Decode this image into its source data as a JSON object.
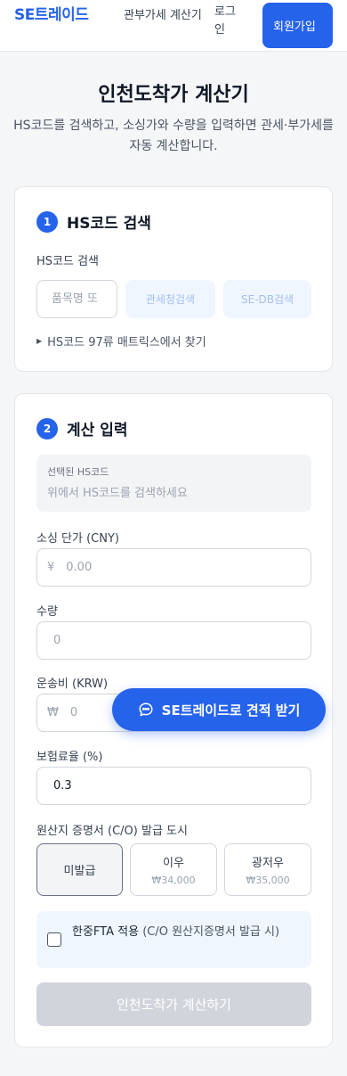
{
  "nav": {
    "logo": "SE트레이드",
    "link_tariff": "관부가세 계산기",
    "link_login": "로그인",
    "signup": "회원가입"
  },
  "page": {
    "title": "인천도착가 계산기",
    "subtitle": "HS코드를 검색하고, 소싱가와 수량을 입력하면 관세·부가세를 자동 계산합니다."
  },
  "step1": {
    "number": "1",
    "title": "HS코드 검색",
    "field_label": "HS코드 검색",
    "search_placeholder": "품목명 또",
    "customs_button": "관세청검색",
    "sedb_button": "SE-DB검색",
    "matrix_toggle": "HS코드 97류 매트릭스에서 찾기"
  },
  "step2": {
    "number": "2",
    "title": "계산 입력",
    "selected_hs_label": "선택된 HS코드",
    "selected_hs_value": "위에서 HS코드를 검색하세요",
    "unit_price_label": "소싱 단가 (CNY)",
    "unit_price_prefix": "¥",
    "unit_price_value": "0.00",
    "quantity_label": "수량",
    "quantity_value": "0",
    "shipping_label": "운송비 (KRW)",
    "shipping_prefix": "₩",
    "shipping_value": "0",
    "insurance_label": "보험료율 (%)",
    "insurance_value": "0.3",
    "origin_label": "원산지 증명서 (C/O) 발급 도시",
    "origin_options": [
      {
        "name": "미발급",
        "price": ""
      },
      {
        "name": "이우",
        "price": "₩34,000"
      },
      {
        "name": "광저우",
        "price": "₩35,000"
      }
    ],
    "origin_selected": "미발급",
    "fta_label": "한중FTA 적용",
    "fta_sub": "(C/O 원산지증명서 발급 시)",
    "fta_checked": false,
    "calc_button": "인천도착가 계산하기"
  },
  "fab": {
    "label": "SE트레이드로 견적 받기",
    "icon": "chat-icon"
  },
  "colors": {
    "accent": "#2563eb",
    "background": "#f5f6f8",
    "disabled": "#d1d5db"
  }
}
